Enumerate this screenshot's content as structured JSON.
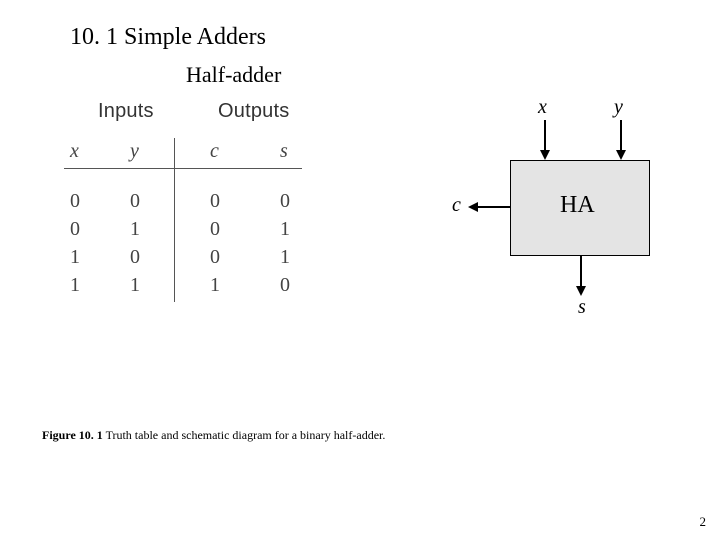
{
  "section_title": "10. 1 Simple Adders",
  "sub_title": "Half-adder",
  "truth_table": {
    "header_inputs": "Inputs",
    "header_outputs": "Outputs",
    "cols": [
      "x",
      "y",
      "c",
      "s"
    ],
    "rows": [
      [
        "0",
        "0",
        "0",
        "0"
      ],
      [
        "0",
        "1",
        "0",
        "1"
      ],
      [
        "1",
        "0",
        "0",
        "1"
      ],
      [
        "1",
        "1",
        "1",
        "0"
      ]
    ]
  },
  "diagram": {
    "block_label": "HA",
    "signals": {
      "in1": "x",
      "in2": "y",
      "out_carry": "c",
      "out_sum": "s"
    }
  },
  "caption": {
    "label": "Figure 10. 1",
    "text": "  Truth table and schematic diagram for a binary half-adder."
  },
  "page_number": "2"
}
